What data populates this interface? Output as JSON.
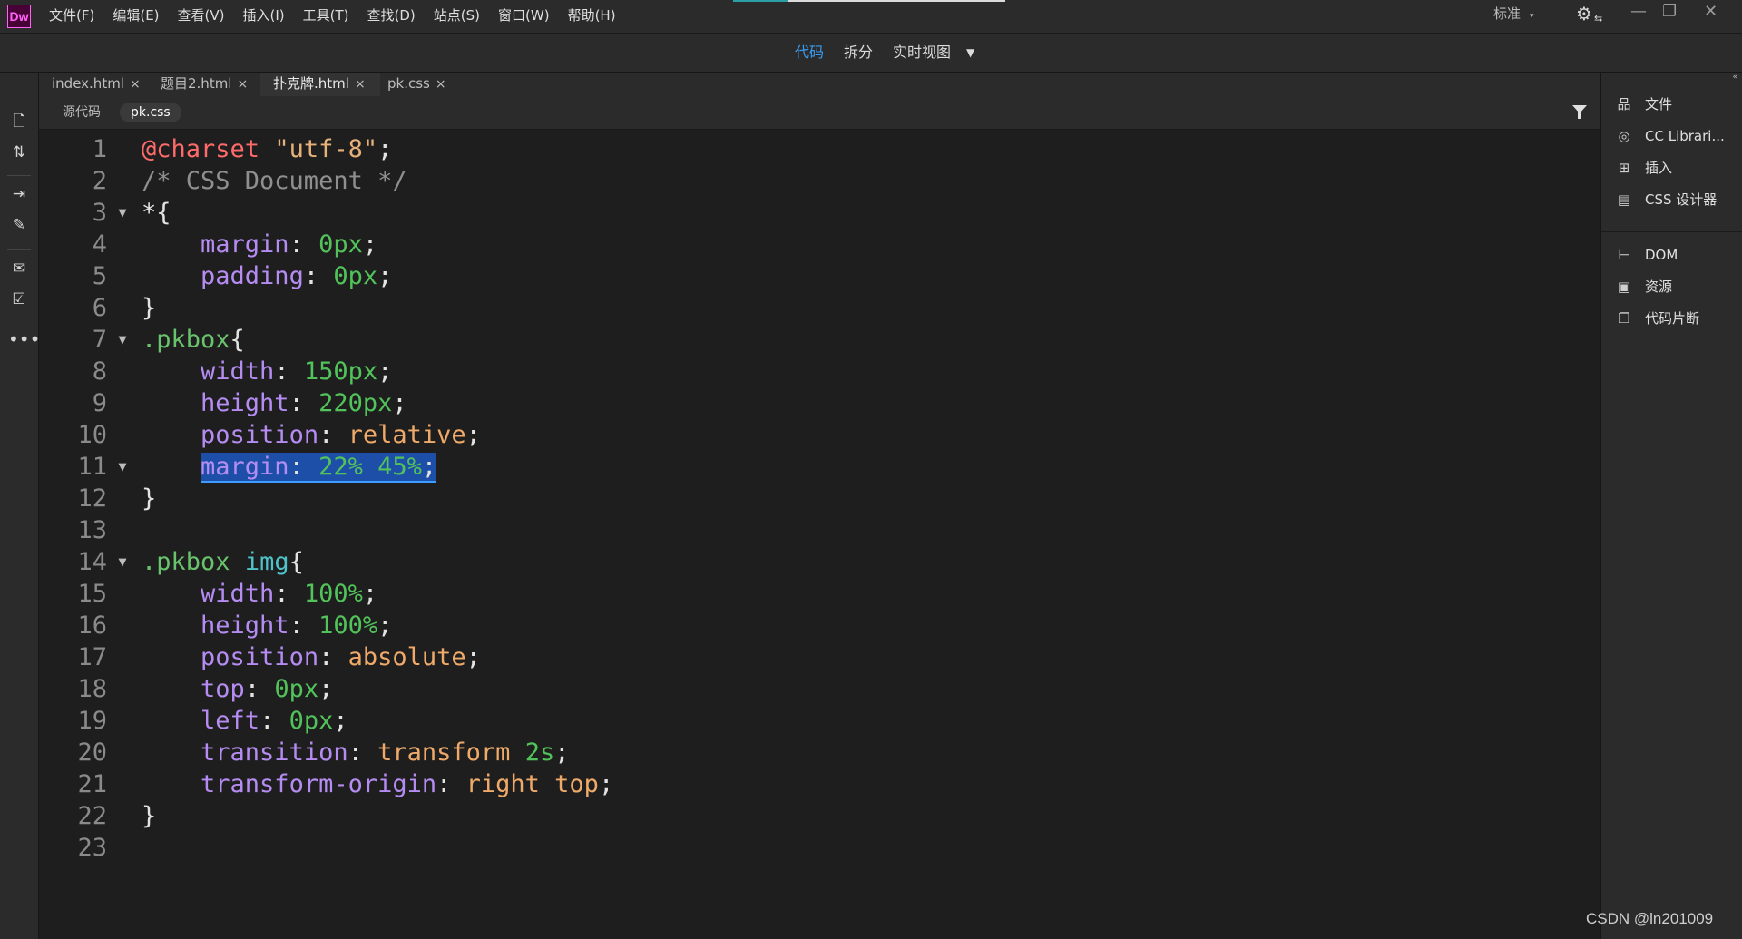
{
  "app": {
    "logo": "Dw"
  },
  "menu": [
    "文件(F)",
    "编辑(E)",
    "查看(V)",
    "插入(I)",
    "工具(T)",
    "查找(D)",
    "站点(S)",
    "窗口(W)",
    "帮助(H)"
  ],
  "workspace": {
    "label": "标准",
    "caret": "▾"
  },
  "window_controls": {
    "minimize": "—",
    "restore": "❐",
    "close": "✕"
  },
  "view_modes": {
    "code": "代码",
    "split": "拆分",
    "live": "实时视图",
    "caret": "▼"
  },
  "tabs": [
    {
      "label": "index.html",
      "close": "×"
    },
    {
      "label": "题目2.html",
      "close": "×"
    },
    {
      "label": "扑克牌.html",
      "close": "×"
    },
    {
      "label": "pk.css",
      "close": "×"
    }
  ],
  "related_files": {
    "source": "源代码",
    "active": "pk.css"
  },
  "left_toolbar_icons": [
    "file-icon",
    "sort-icon",
    "expand-icon",
    "brush-icon",
    "comment-icon",
    "format-icon",
    "more-icon"
  ],
  "code": {
    "lines": [
      {
        "n": "1",
        "fold": "",
        "tokens": [
          [
            "at",
            "@charset"
          ],
          [
            "plain",
            " "
          ],
          [
            "str",
            "\"utf-8\""
          ],
          [
            "plain",
            ";"
          ]
        ]
      },
      {
        "n": "2",
        "fold": "",
        "tokens": [
          [
            "cmt",
            "/* CSS Document */"
          ]
        ]
      },
      {
        "n": "3",
        "fold": "▼",
        "tokens": [
          [
            "plain",
            "*{"
          ]
        ]
      },
      {
        "n": "4",
        "fold": "",
        "tokens": [
          [
            "plain",
            "    "
          ],
          [
            "prop",
            "margin"
          ],
          [
            "plain",
            ": "
          ],
          [
            "num",
            "0px"
          ],
          [
            "plain",
            ";"
          ]
        ]
      },
      {
        "n": "5",
        "fold": "",
        "tokens": [
          [
            "plain",
            "    "
          ],
          [
            "prop",
            "padding"
          ],
          [
            "plain",
            ": "
          ],
          [
            "num",
            "0px"
          ],
          [
            "plain",
            ";"
          ]
        ]
      },
      {
        "n": "6",
        "fold": "",
        "tokens": [
          [
            "plain",
            "}"
          ]
        ]
      },
      {
        "n": "7",
        "fold": "▼",
        "tokens": [
          [
            "sel",
            ".pkbox"
          ],
          [
            "plain",
            "{"
          ]
        ]
      },
      {
        "n": "8",
        "fold": "",
        "tokens": [
          [
            "plain",
            "    "
          ],
          [
            "prop",
            "width"
          ],
          [
            "plain",
            ": "
          ],
          [
            "num",
            "150px"
          ],
          [
            "plain",
            ";"
          ]
        ]
      },
      {
        "n": "9",
        "fold": "",
        "tokens": [
          [
            "plain",
            "    "
          ],
          [
            "prop",
            "height"
          ],
          [
            "plain",
            ": "
          ],
          [
            "num",
            "220px"
          ],
          [
            "plain",
            ";"
          ]
        ]
      },
      {
        "n": "10",
        "fold": "",
        "tokens": [
          [
            "plain",
            "    "
          ],
          [
            "prop",
            "position"
          ],
          [
            "plain",
            ": "
          ],
          [
            "kw",
            "relative"
          ],
          [
            "plain",
            ";"
          ]
        ]
      },
      {
        "n": "11",
        "fold": "▼",
        "tokens": [
          [
            "plain",
            "    "
          ],
          [
            "prop hl",
            "margin"
          ],
          [
            "plain hl",
            ": "
          ],
          [
            "num hl",
            "22% 45%"
          ],
          [
            "plain hl",
            ";"
          ]
        ]
      },
      {
        "n": "12",
        "fold": "",
        "tokens": [
          [
            "plain",
            "}"
          ]
        ]
      },
      {
        "n": "13",
        "fold": "",
        "tokens": []
      },
      {
        "n": "14",
        "fold": "▼",
        "tokens": [
          [
            "sel",
            ".pkbox"
          ],
          [
            "plain",
            " "
          ],
          [
            "tag",
            "img"
          ],
          [
            "plain",
            "{"
          ]
        ]
      },
      {
        "n": "15",
        "fold": "",
        "tokens": [
          [
            "plain",
            "    "
          ],
          [
            "prop",
            "width"
          ],
          [
            "plain",
            ": "
          ],
          [
            "num",
            "100%"
          ],
          [
            "plain",
            ";"
          ]
        ]
      },
      {
        "n": "16",
        "fold": "",
        "tokens": [
          [
            "plain",
            "    "
          ],
          [
            "prop",
            "height"
          ],
          [
            "plain",
            ": "
          ],
          [
            "num",
            "100%"
          ],
          [
            "plain",
            ";"
          ]
        ]
      },
      {
        "n": "17",
        "fold": "",
        "tokens": [
          [
            "plain",
            "    "
          ],
          [
            "prop",
            "position"
          ],
          [
            "plain",
            ": "
          ],
          [
            "kw",
            "absolute"
          ],
          [
            "plain",
            ";"
          ]
        ]
      },
      {
        "n": "18",
        "fold": "",
        "tokens": [
          [
            "plain",
            "    "
          ],
          [
            "prop",
            "top"
          ],
          [
            "plain",
            ": "
          ],
          [
            "num",
            "0px"
          ],
          [
            "plain",
            ";"
          ]
        ]
      },
      {
        "n": "19",
        "fold": "",
        "tokens": [
          [
            "plain",
            "    "
          ],
          [
            "prop",
            "left"
          ],
          [
            "plain",
            ": "
          ],
          [
            "num",
            "0px"
          ],
          [
            "plain",
            ";"
          ]
        ]
      },
      {
        "n": "20",
        "fold": "",
        "tokens": [
          [
            "plain",
            "    "
          ],
          [
            "prop",
            "transition"
          ],
          [
            "plain",
            ": "
          ],
          [
            "kw",
            "transform"
          ],
          [
            "plain",
            " "
          ],
          [
            "num",
            "2s"
          ],
          [
            "plain",
            ";"
          ]
        ]
      },
      {
        "n": "21",
        "fold": "",
        "tokens": [
          [
            "plain",
            "    "
          ],
          [
            "prop",
            "transform-origin"
          ],
          [
            "plain",
            ": "
          ],
          [
            "kw",
            "right top"
          ],
          [
            "plain",
            ";"
          ]
        ]
      },
      {
        "n": "22",
        "fold": "",
        "tokens": [
          [
            "plain",
            "}"
          ]
        ]
      },
      {
        "n": "23",
        "fold": "",
        "tokens": []
      }
    ]
  },
  "right_panel": {
    "group1": [
      {
        "label": "文件",
        "icon": "files-icon"
      },
      {
        "label": "CC Librari...",
        "icon": "cc-libraries-icon"
      },
      {
        "label": "插入",
        "icon": "insert-icon"
      },
      {
        "label": "CSS 设计器",
        "icon": "css-designer-icon"
      }
    ],
    "group2": [
      {
        "label": "DOM",
        "icon": "dom-icon"
      },
      {
        "label": "资源",
        "icon": "assets-icon"
      },
      {
        "label": "代码片断",
        "icon": "snippets-icon"
      }
    ]
  },
  "watermark": "CSDN @ln201009"
}
